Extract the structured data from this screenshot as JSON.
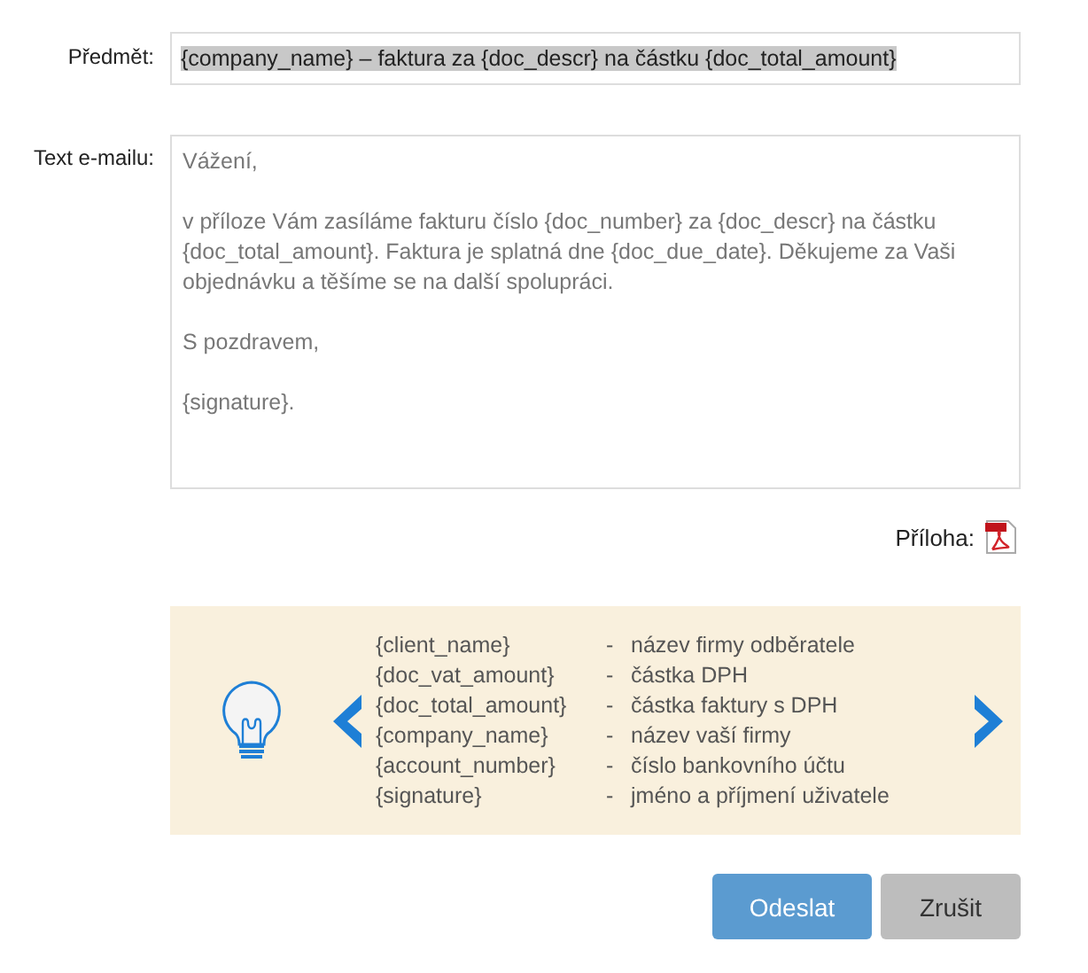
{
  "subject": {
    "label": "Předmět:",
    "value": "{company_name} – faktura za {doc_descr} na částku {doc_total_amount}",
    "selected": true
  },
  "body": {
    "label": "Text e-mailu:",
    "value": "Vážení,\n\nv příloze Vám zasíláme fakturu číslo {doc_number} za {doc_descr} na částku {doc_total_amount}. Faktura je splatná dne {doc_due_date}. Děkujeme za Vaši objednávku a těšíme se na další spolupráci.\n\nS pozdravem,\n\n{signature}."
  },
  "attachment": {
    "label": "Příloha:"
  },
  "hints": [
    {
      "variable": "{client_name}",
      "separator": "-",
      "description": "název firmy odběratele"
    },
    {
      "variable": "{doc_vat_amount}",
      "separator": "-",
      "description": "částka DPH"
    },
    {
      "variable": "{doc_total_amount}",
      "separator": "-",
      "description": "částka faktury s DPH"
    },
    {
      "variable": "{company_name}",
      "separator": "-",
      "description": "název vaší firmy"
    },
    {
      "variable": "{account_number}",
      "separator": "-",
      "description": "číslo bankovního účtu"
    },
    {
      "variable": "{signature}",
      "separator": "-",
      "description": "jméno a příjmení uživatele"
    }
  ],
  "buttons": [
    {
      "label": "Odeslat",
      "kind": "primary"
    },
    {
      "label": "Zrušit",
      "kind": "secondary"
    }
  ]
}
